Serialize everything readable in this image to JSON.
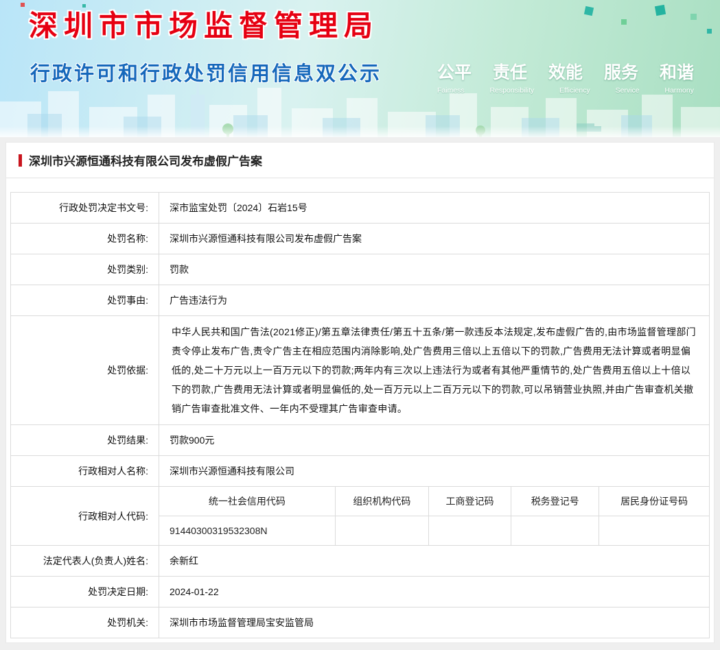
{
  "colors": {
    "title_red": "#e60012",
    "subtitle_blue": "#1668bb",
    "accent_bar_red": "#c9151e",
    "banner_teal": "#2fb7a6"
  },
  "header": {
    "org_name": "深圳市市场监督管理局",
    "subtitle": "行政许可和行政处罚信用信息双公示",
    "slogan_cn": [
      "公平",
      "责任",
      "效能",
      "服务",
      "和谐"
    ],
    "slogan_en": [
      "Faimess",
      "Responsibility",
      "Efficiency",
      "Service",
      "Harmony"
    ]
  },
  "page_title": "深圳市兴源恒通科技有限公司发布虚假广告案",
  "record": {
    "rows": [
      {
        "label": "行政处罚决定书文号:",
        "value": "深市监宝处罚〔2024〕石岩15号"
      },
      {
        "label": "处罚名称:",
        "value": "深圳市兴源恒通科技有限公司发布虚假广告案"
      },
      {
        "label": "处罚类别:",
        "value": "罚款"
      },
      {
        "label": "处罚事由:",
        "value": "广告违法行为"
      },
      {
        "label": "处罚依据:",
        "value": "中华人民共和国广告法(2021修正)/第五章法律责任/第五十五条/第一款违反本法规定,发布虚假广告的,由市场监督管理部门责令停止发布广告,责令广告主在相应范围内消除影响,处广告费用三倍以上五倍以下的罚款,广告费用无法计算或者明显偏低的,处二十万元以上一百万元以下的罚款;两年内有三次以上违法行为或者有其他严重情节的,处广告费用五倍以上十倍以下的罚款,广告费用无法计算或者明显偏低的,处一百万元以上二百万元以下的罚款,可以吊销营业执照,并由广告审查机关撤销广告审查批准文件、一年内不受理其广告审查申请。"
      },
      {
        "label": "处罚结果:",
        "value": "罚款900元"
      },
      {
        "label": "行政相对人名称:",
        "value": "深圳市兴源恒通科技有限公司"
      }
    ],
    "codes": {
      "label": "行政相对人代码:",
      "columns": [
        "统一社会信用代码",
        "组织机构代码",
        "工商登记码",
        "税务登记号",
        "居民身份证号码"
      ],
      "values": [
        "91440300319532308N",
        "",
        "",
        "",
        ""
      ]
    },
    "rows_after": [
      {
        "label": "法定代表人(负责人)姓名:",
        "value": "余新红"
      },
      {
        "label": "处罚决定日期:",
        "value": "2024-01-22"
      },
      {
        "label": "处罚机关:",
        "value": "深圳市市场监督管理局宝安监管局"
      }
    ]
  }
}
